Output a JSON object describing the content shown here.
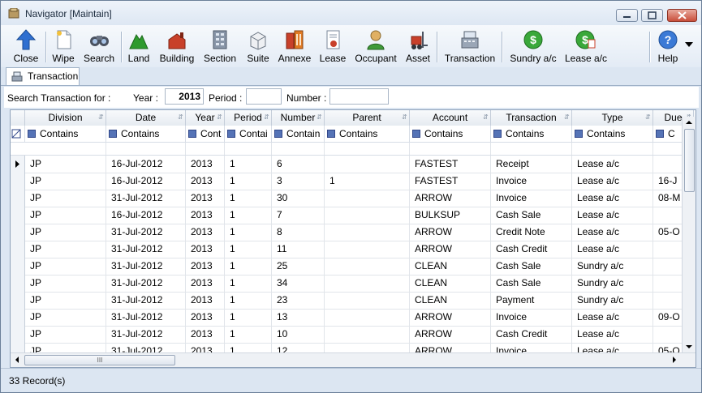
{
  "window": {
    "title": "Navigator [Maintain]"
  },
  "toolbar": {
    "buttons": [
      {
        "label": "Close",
        "icon": "up-arrow-icon"
      },
      {
        "label": "Wipe",
        "icon": "blank-page-icon"
      },
      {
        "label": "Search",
        "icon": "binoculars-icon"
      },
      {
        "label": "Land",
        "icon": "land-icon"
      },
      {
        "label": "Building",
        "icon": "building-icon"
      },
      {
        "label": "Section",
        "icon": "section-icon"
      },
      {
        "label": "Suite",
        "icon": "suite-icon"
      },
      {
        "label": "Annexe",
        "icon": "annexe-icon"
      },
      {
        "label": "Lease",
        "icon": "lease-document-icon"
      },
      {
        "label": "Occupant",
        "icon": "person-icon"
      },
      {
        "label": "Asset",
        "icon": "forklift-icon"
      },
      {
        "label": "Transaction",
        "icon": "register-icon"
      },
      {
        "label": "Sundry a/c",
        "icon": "dollar-coin-icon"
      },
      {
        "label": "Lease a/c",
        "icon": "lease-dollar-icon"
      },
      {
        "label": "Help",
        "icon": "help-icon"
      }
    ],
    "colors": {
      "blue": "#2f6fd0",
      "green": "#2e9a2e",
      "red": "#c8402a",
      "orange": "#e07a24"
    }
  },
  "tab": {
    "label": "Transaction"
  },
  "search": {
    "label": "Search Transaction for :",
    "year_label": "Year :",
    "year_value": "2013",
    "period_label": "Period :",
    "period_value": "",
    "number_label": "Number :",
    "number_value": ""
  },
  "grid": {
    "columns": [
      "Division",
      "Date",
      "Year",
      "Period",
      "Number",
      "Parent",
      "Account",
      "Transaction",
      "Type",
      "Due"
    ],
    "filters": [
      "Contains",
      "Contains",
      "Cont",
      "Contai",
      "Contain",
      "Contains",
      "Contains",
      "Contains",
      "Contains",
      "C"
    ],
    "rows": [
      [
        "JP",
        "16-Jul-2012",
        "2013",
        "1",
        "6",
        "",
        "FASTEST",
        "Receipt",
        "Lease a/c",
        ""
      ],
      [
        "JP",
        "16-Jul-2012",
        "2013",
        "1",
        "3",
        "1",
        "FASTEST",
        "Invoice",
        "Lease a/c",
        "16-J"
      ],
      [
        "JP",
        "31-Jul-2012",
        "2013",
        "1",
        "30",
        "",
        "ARROW",
        "Invoice",
        "Lease a/c",
        "08-M"
      ],
      [
        "JP",
        "16-Jul-2012",
        "2013",
        "1",
        "7",
        "",
        "BULKSUP",
        "Cash Sale",
        "Lease a/c",
        ""
      ],
      [
        "JP",
        "31-Jul-2012",
        "2013",
        "1",
        "8",
        "",
        "ARROW",
        "Credit Note",
        "Lease a/c",
        "05-O"
      ],
      [
        "JP",
        "31-Jul-2012",
        "2013",
        "1",
        "11",
        "",
        "ARROW",
        "Cash Credit",
        "Lease a/c",
        ""
      ],
      [
        "JP",
        "31-Jul-2012",
        "2013",
        "1",
        "25",
        "",
        "CLEAN",
        "Cash Sale",
        "Sundry a/c",
        ""
      ],
      [
        "JP",
        "31-Jul-2012",
        "2013",
        "1",
        "34",
        "",
        "CLEAN",
        "Cash Sale",
        "Sundry a/c",
        ""
      ],
      [
        "JP",
        "31-Jul-2012",
        "2013",
        "1",
        "23",
        "",
        "CLEAN",
        "Payment",
        "Sundry a/c",
        ""
      ],
      [
        "JP",
        "31-Jul-2012",
        "2013",
        "1",
        "13",
        "",
        "ARROW",
        "Invoice",
        "Lease a/c",
        "09-O"
      ],
      [
        "JP",
        "31-Jul-2012",
        "2013",
        "1",
        "10",
        "",
        "ARROW",
        "Cash Credit",
        "Lease a/c",
        ""
      ],
      [
        "JP",
        "31-Jul-2012",
        "2013",
        "1",
        "12",
        "",
        "ARROW",
        "Invoice",
        "Lease a/c",
        "05-O"
      ]
    ],
    "scroll_label": "III"
  },
  "status": {
    "text": "33 Record(s)"
  }
}
